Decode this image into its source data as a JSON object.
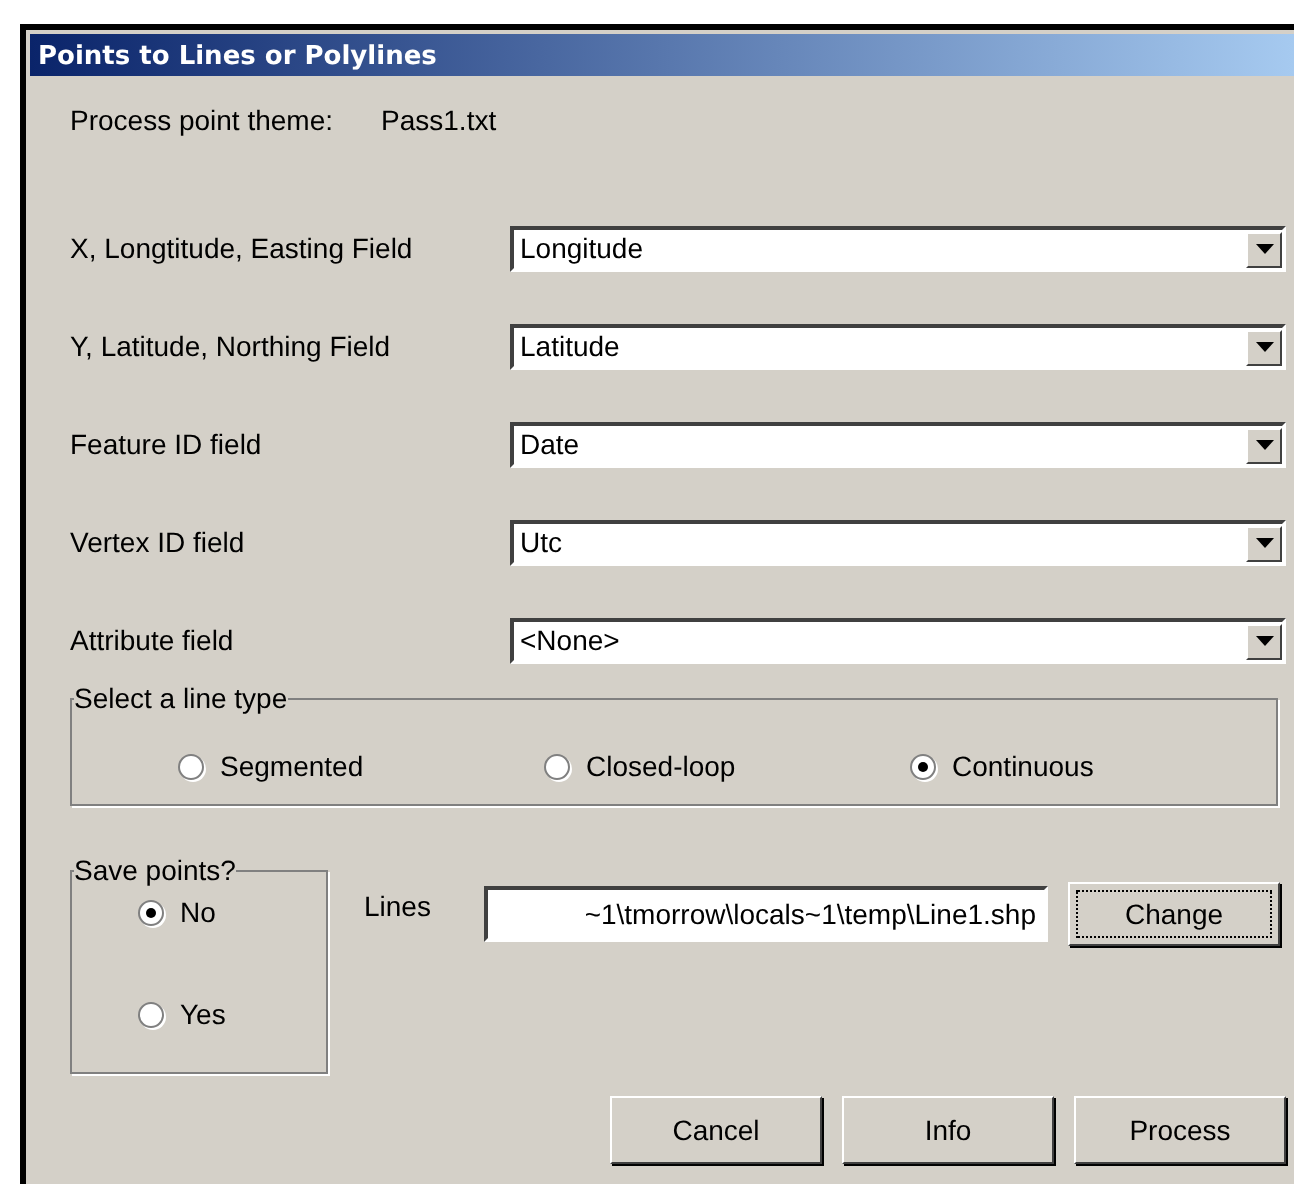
{
  "window": {
    "title": "Points to Lines or Polylines"
  },
  "theme": {
    "label": "Process point theme:",
    "value": "Pass1.txt"
  },
  "fields": [
    {
      "label": "X, Longtitude, Easting Field",
      "value": "Longitude"
    },
    {
      "label": "Y, Latitude, Northing Field",
      "value": "Latitude"
    },
    {
      "label": "Feature ID field",
      "value": "Date"
    },
    {
      "label": "Vertex ID field",
      "value": "Utc"
    },
    {
      "label": "Attribute field",
      "value": "<None>"
    }
  ],
  "line_type": {
    "title": "Select a line type",
    "options": [
      {
        "label": "Segmented",
        "selected": false
      },
      {
        "label": "Closed-loop",
        "selected": false
      },
      {
        "label": "Continuous",
        "selected": true
      }
    ]
  },
  "save_points": {
    "title": "Save points?",
    "options": [
      {
        "label": "No",
        "selected": true
      },
      {
        "label": "Yes",
        "selected": false
      }
    ]
  },
  "lines": {
    "label": "Lines",
    "value": "~1\\tmorrow\\locals~1\\temp\\Line1.shp",
    "button": "Change"
  },
  "buttons": [
    "Cancel",
    "Info",
    "Process"
  ]
}
